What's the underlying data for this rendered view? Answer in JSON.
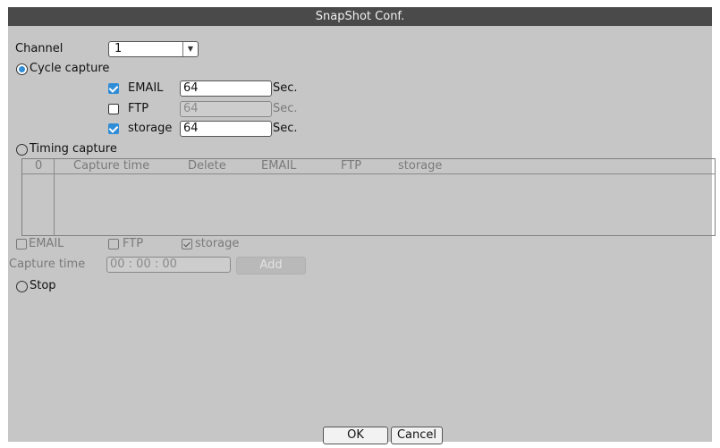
{
  "window": {
    "title": "SnapShot Conf."
  },
  "channel": {
    "label": "Channel",
    "value": "1",
    "arrow_icon": "triangle-down"
  },
  "cycle_capture": {
    "label": "Cycle capture",
    "selected": true,
    "rows": [
      {
        "label": "EMAIL",
        "checked": true,
        "enabled": true,
        "value": "64",
        "unit": "Sec."
      },
      {
        "label": "FTP",
        "checked": false,
        "enabled": false,
        "value": "64",
        "unit": "Sec."
      },
      {
        "label": "storage",
        "checked": true,
        "enabled": true,
        "value": "64",
        "unit": "Sec."
      }
    ]
  },
  "timing_capture": {
    "label": "Timing capture",
    "selected": false,
    "table": {
      "columns": [
        "0",
        "Capture time",
        "Delete",
        "EMAIL",
        "FTP",
        "storage"
      ],
      "rows": []
    },
    "options": [
      {
        "label": "EMAIL",
        "checked": false
      },
      {
        "label": "FTP",
        "checked": false
      },
      {
        "label": "storage",
        "checked": true
      }
    ],
    "capture_time_label": "Capture time",
    "capture_time_value": "00 : 00 : 00",
    "add_label": "Add"
  },
  "stop": {
    "label": "Stop",
    "selected": false
  },
  "footer": {
    "ok_label": "OK",
    "cancel_label": "Cancel"
  },
  "colors": {
    "titlebar": "#4a4a4a",
    "panel": "#c6c6c6",
    "accent": "#2f8cd6"
  }
}
